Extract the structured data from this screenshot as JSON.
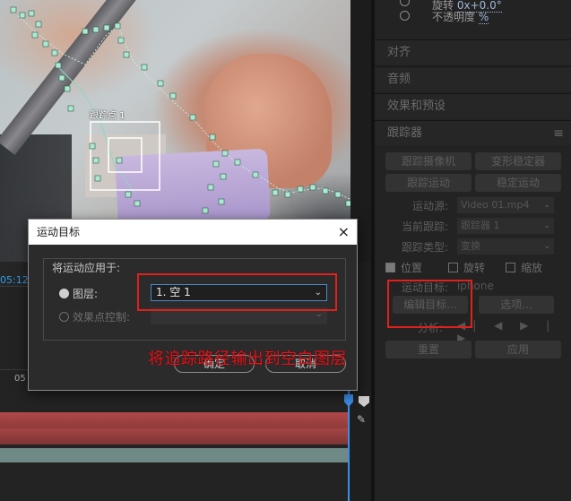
{
  "viewer": {
    "track_point_label": "跟踪点 1"
  },
  "timeline": {
    "timecode": "05:12",
    "ruler_label": "05"
  },
  "panel": {
    "top_rows": {
      "rotation_label": "旋转",
      "rotation_value": "0x+0.0°",
      "opacity_label": "不透明度",
      "opacity_value": "%"
    },
    "sections": {
      "align": "对齐",
      "audio": "音频",
      "effects_presets": "效果和预设",
      "tracker": "跟踪器"
    },
    "tracker": {
      "track_camera": "跟踪摄像机",
      "warp_stabilizer": "变形稳定器",
      "track_motion": "跟踪运动",
      "stabilize_motion": "稳定运动",
      "motion_source_label": "运动源:",
      "motion_source_value": "Video 01.mp4",
      "current_track_label": "当前跟踪:",
      "current_track_value": "跟踪器 1",
      "track_type_label": "跟踪类型:",
      "track_type_value": "变换",
      "position_label": "位置",
      "rotation_label": "旋转",
      "scale_label": "缩放",
      "motion_target_label": "运动目标:",
      "motion_target_value": "iphone",
      "edit_target": "编辑目标...",
      "options": "选项...",
      "analyze_label": "分析:",
      "reset": "重置",
      "apply": "应用"
    }
  },
  "dialog": {
    "title": "运动目标",
    "close": "×",
    "apply_to_label": "将运动应用于:",
    "layer_label": "图层:",
    "layer_value": "1. 空 1",
    "effect_point_label": "效果点控制:",
    "ok": "确定",
    "cancel": "取消"
  },
  "caption": "将追踪路径输出到空白图层",
  "colors": {
    "accent_blue": "#2f9be8",
    "highlight_red": "#e0201a",
    "panel_bg": "#232323"
  }
}
